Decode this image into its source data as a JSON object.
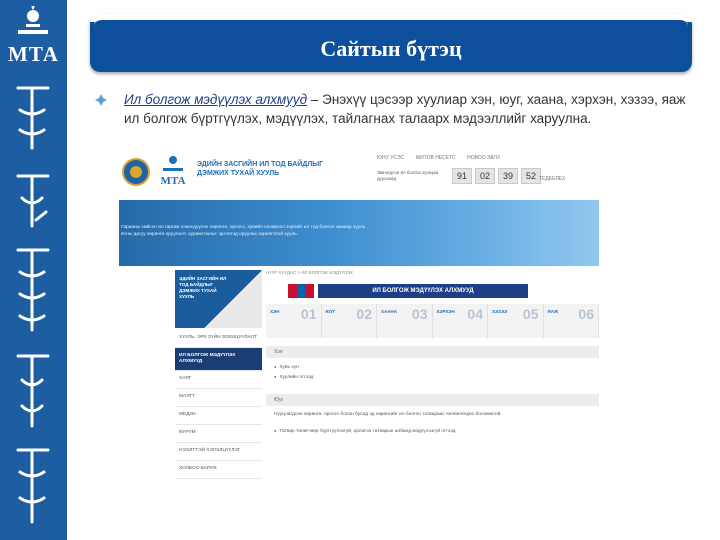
{
  "brand": {
    "abbreviation": "МТА",
    "colors": {
      "band": "#1d5ea3",
      "title_bar": "#0d4f9c",
      "accent": "#1d3f86"
    }
  },
  "slide": {
    "title": "Сайтын бүтэц",
    "bullet": {
      "icon": "diamond-bullet-icon",
      "emphasis": "Ил болгож мэдүүлэх алхмууд",
      "text": " – Энэхүү цэсээр хуулиар хэн, юуг, хаана, хэрхэн, хэзээ, яаж ил болгож бүртгүүлэх, мэдүүлэх, тайлагнах талаарх мэдээллийг харуулна."
    }
  },
  "site": {
    "name": "ЭДИЙН ЗАСГИЙН ИЛ ТОД БАЙДЛЫГ ДЭМЖИХ ТУХАЙ ХУУЛЬ",
    "top_links": [
      "ЮНУ УСЭС",
      "ЖИТОВ НЕСЕТС",
      "НОВОО ЗАГИ"
    ],
    "countdown": {
      "label": "Эмнэгдсэн ил болгох хугацаа дуусахад",
      "values": [
        "91",
        "02",
        "39",
        "52"
      ],
      "extra": "ТЕДЕЕЛЕХ"
    },
    "hero_text": "Гарааны хийсэн ил гаргаж нэмэгдүүлэх хөрөнгө, орлого, хувийн сонирхол зэргийг ил тод болгох замаар хууль ёсны дагуу хөрөнгө оруулалт, хуримтлалыг эргэлтэд оруулах зорилготой хууль.",
    "nav_brand": "ЭДИЙН ЗАСГИЙН ИЛ ТОД БАЙДЛЫГ ДЭМЖИХ ТУХАЙ ХУУЛЬ",
    "nav_items": [
      {
        "label": "ХУУЛЬ, ЭРХ ЗҮЙН ЗОХИЦУУЛАЛТ",
        "active": false
      },
      {
        "label": "ИЛ БОЛГОЖ МЭДҮҮЛЭХ АЛХМУУД",
        "active": true
      },
      {
        "label": "ХАЯГ",
        "active": false
      },
      {
        "label": "МАЯГТ",
        "active": false
      },
      {
        "label": "МЕДИА",
        "active": false
      },
      {
        "label": "ФУРУМ",
        "active": false
      },
      {
        "label": "НЭЭЛТТЭЙ ХЭЛЭЛЦҮҮЛЭГ",
        "active": false
      },
      {
        "label": "ХОЛБОО БАРИХ",
        "active": false
      }
    ],
    "breadcrumb": "НҮҮР ХУУДАС > ИЛ БОЛГОЖ МЭДҮҮЛЭХ",
    "ribbon": "ИЛ БОЛГОЖ МЭДҮҮЛЭХ АЛХМУУД",
    "steps": [
      {
        "label": "ХЭН",
        "num": "01"
      },
      {
        "label": "ЮУГ",
        "num": "02"
      },
      {
        "label": "ХААНА",
        "num": "03"
      },
      {
        "label": "ХЭРХЭН",
        "num": "04"
      },
      {
        "label": "ХЭЗЭЭ",
        "num": "05"
      },
      {
        "label": "ЯАЖ",
        "num": "06"
      }
    ],
    "sections": {
      "who": {
        "heading": "Хэн",
        "items": [
          "Хувь хүн",
          "Хуулийн этгээд"
        ]
      },
      "what": {
        "heading": "Юуг",
        "text": "Нууцлагдсан хөрөнгө, орлого болон бусад эд хөрөнгийг ил болгон татвараас чөлөөлөгдөх боломжтой.",
        "item": "Татвар төлөгчөөр бүртгүүлээгүй, орлогоо татварын албанд мэдүүлээгүй этгээд."
      }
    }
  }
}
